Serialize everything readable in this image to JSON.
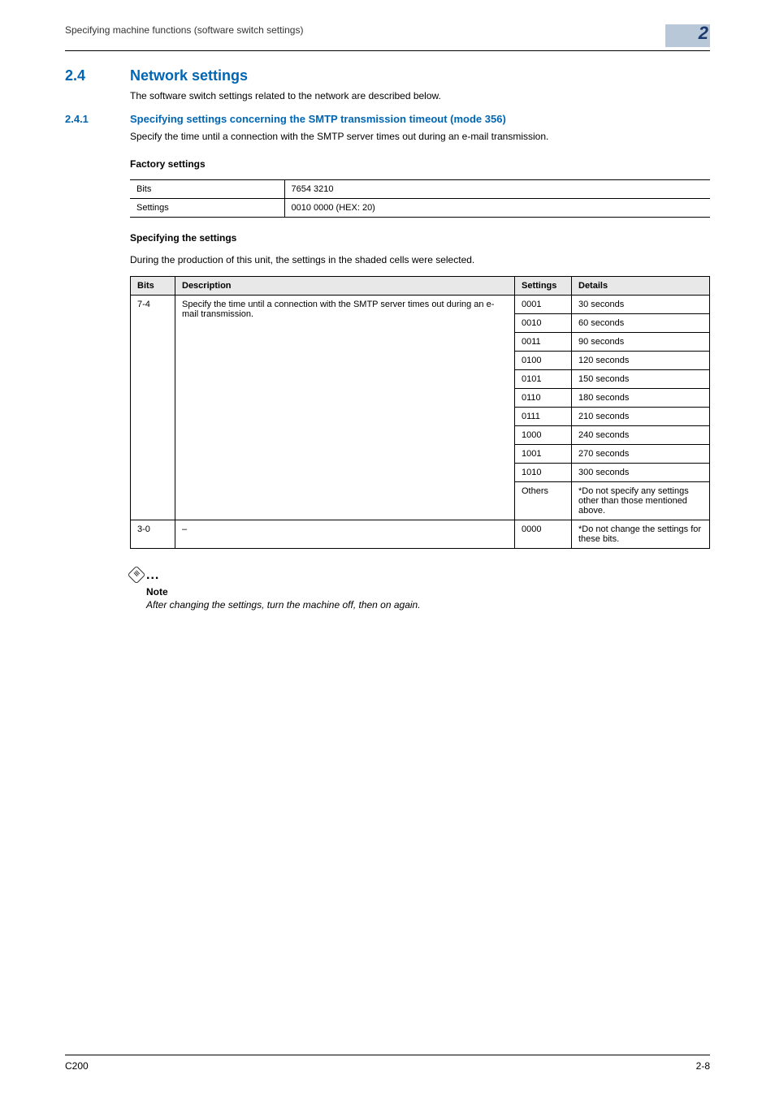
{
  "header": {
    "title": "Specifying machine functions (software switch settings)",
    "chapter": "2"
  },
  "section": {
    "num": "2.4",
    "title": "Network settings",
    "intro": "The software switch settings related to the network are described below."
  },
  "subsection": {
    "num": "2.4.1",
    "title": "Specifying settings concerning the SMTP transmission timeout (mode 356)",
    "intro": "Specify the time until a connection with the SMTP server times out during an e-mail transmission."
  },
  "factory": {
    "heading": "Factory settings",
    "rows": [
      {
        "label": "Bits",
        "value": "7654 3210"
      },
      {
        "label": "Settings",
        "value": "0010 0000 (HEX: 20)"
      }
    ]
  },
  "specifying": {
    "heading": "Specifying the settings",
    "intro": "During the production of this unit, the settings in the shaded cells were selected.",
    "headers": {
      "bits": "Bits",
      "desc": "Description",
      "settings": "Settings",
      "details": "Details"
    },
    "group1": {
      "bits": "7-4",
      "desc": "Specify the time until a connection with the SMTP server times out during an e-mail transmission.",
      "rows": [
        {
          "s": "0001",
          "d": "30 seconds"
        },
        {
          "s": "0010",
          "d": "60 seconds"
        },
        {
          "s": "0011",
          "d": "90 seconds"
        },
        {
          "s": "0100",
          "d": "120 seconds"
        },
        {
          "s": "0101",
          "d": "150 seconds"
        },
        {
          "s": "0110",
          "d": "180 seconds"
        },
        {
          "s": "0111",
          "d": "210 seconds"
        },
        {
          "s": "1000",
          "d": "240 seconds"
        },
        {
          "s": "1001",
          "d": "270 seconds"
        },
        {
          "s": "1010",
          "d": "300 seconds"
        },
        {
          "s": "Others",
          "d": "*Do not specify any settings other than those mentioned above."
        }
      ]
    },
    "group2": {
      "bits": "3-0",
      "desc": "–",
      "s": "0000",
      "d": "*Do not change the settings for these bits."
    }
  },
  "note": {
    "label": "Note",
    "text": "After changing the settings, turn the machine off, then on again."
  },
  "footer": {
    "left": "C200",
    "right": "2-8"
  }
}
